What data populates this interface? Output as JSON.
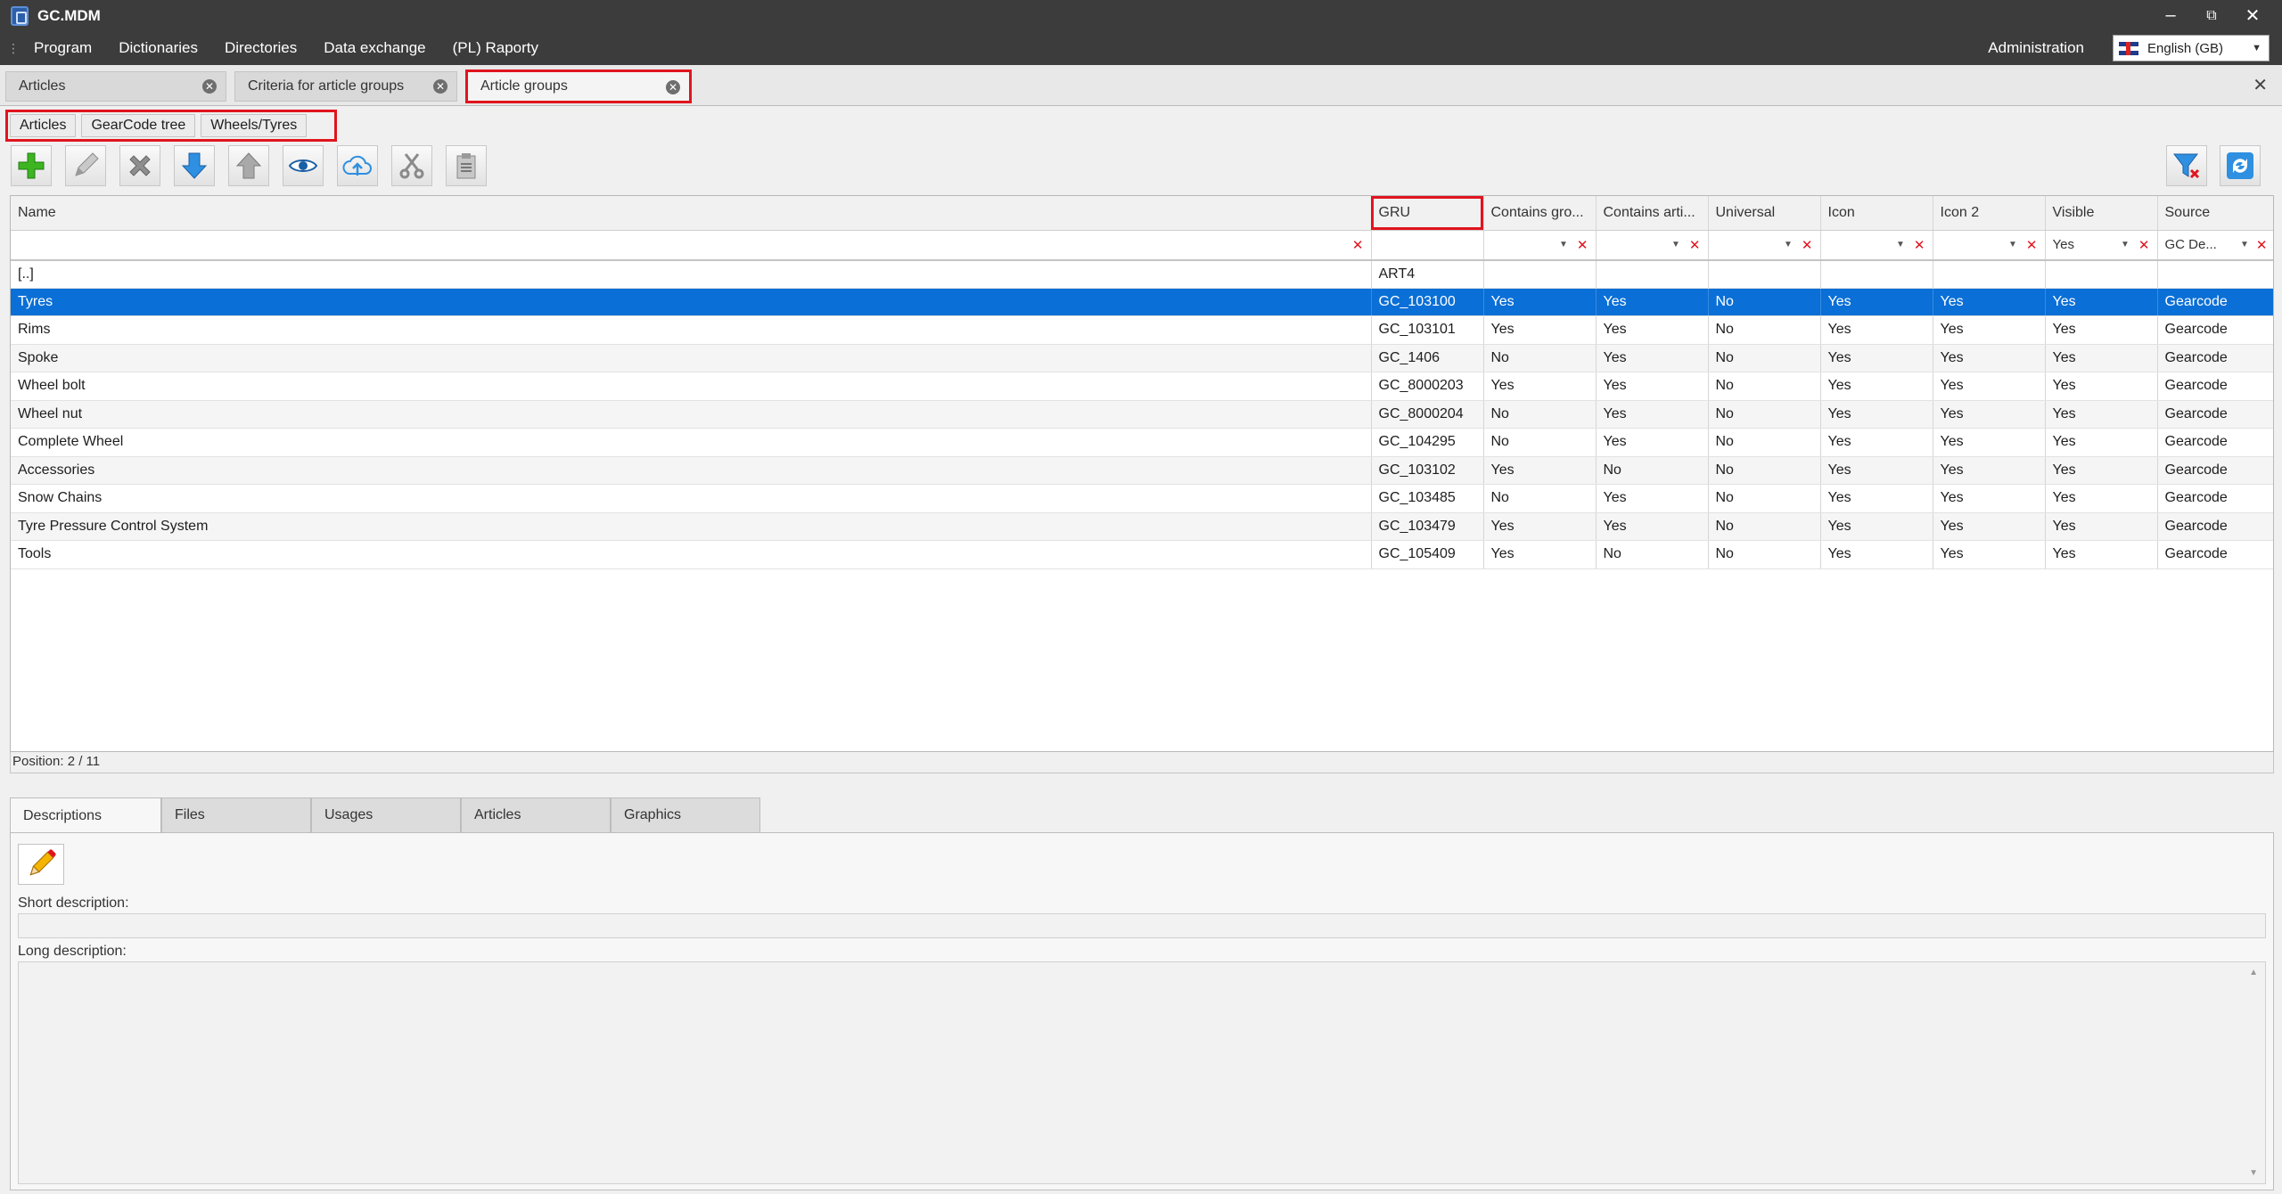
{
  "app": {
    "title": "GC.MDM"
  },
  "window_controls": {
    "minimize": "–",
    "restore": "⧉",
    "close": "✕"
  },
  "menu": {
    "items": [
      "Program",
      "Dictionaries",
      "Directories",
      "Data exchange",
      "(PL) Raporty"
    ],
    "administration": "Administration",
    "language": "English (GB)"
  },
  "doc_tabs": [
    {
      "label": "Articles"
    },
    {
      "label": "Criteria for article groups"
    },
    {
      "label": "Article groups",
      "active": true
    }
  ],
  "sub_tabs": [
    "Articles",
    "GearCode tree",
    "Wheels/Tyres"
  ],
  "toolbar": {
    "icons": [
      "add-icon",
      "edit-icon",
      "delete-icon",
      "move-down-icon",
      "move-up-icon",
      "view-icon",
      "upload-icon",
      "cut-icon",
      "paste-icon"
    ],
    "right_icons": [
      "clear-filter-icon",
      "refresh-icon"
    ]
  },
  "grid": {
    "columns": [
      "Name",
      "GRU",
      "Contains gro...",
      "Contains arti...",
      "Universal",
      "Icon",
      "Icon 2",
      "Visible",
      "Source"
    ],
    "filters": {
      "visible": "Yes",
      "source": "GC De..."
    },
    "rows": [
      [
        "[..]",
        "ART4",
        "",
        "",
        "",
        "",
        "",
        "",
        ""
      ],
      [
        "Tyres",
        "GC_103100",
        "Yes",
        "Yes",
        "No",
        "Yes",
        "Yes",
        "Yes",
        "Gearcode"
      ],
      [
        "Rims",
        "GC_103101",
        "Yes",
        "Yes",
        "No",
        "Yes",
        "Yes",
        "Yes",
        "Gearcode"
      ],
      [
        "Spoke",
        "GC_1406",
        "No",
        "Yes",
        "No",
        "Yes",
        "Yes",
        "Yes",
        "Gearcode"
      ],
      [
        "Wheel bolt",
        "GC_8000203",
        "Yes",
        "Yes",
        "No",
        "Yes",
        "Yes",
        "Yes",
        "Gearcode"
      ],
      [
        "Wheel nut",
        "GC_8000204",
        "No",
        "Yes",
        "No",
        "Yes",
        "Yes",
        "Yes",
        "Gearcode"
      ],
      [
        "Complete Wheel",
        "GC_104295",
        "No",
        "Yes",
        "No",
        "Yes",
        "Yes",
        "Yes",
        "Gearcode"
      ],
      [
        "Accessories",
        "GC_103102",
        "Yes",
        "No",
        "No",
        "Yes",
        "Yes",
        "Yes",
        "Gearcode"
      ],
      [
        "Snow Chains",
        "GC_103485",
        "No",
        "Yes",
        "No",
        "Yes",
        "Yes",
        "Yes",
        "Gearcode"
      ],
      [
        "Tyre Pressure Control System",
        "GC_103479",
        "Yes",
        "Yes",
        "No",
        "Yes",
        "Yes",
        "Yes",
        "Gearcode"
      ],
      [
        "Tools",
        "GC_105409",
        "Yes",
        "No",
        "No",
        "Yes",
        "Yes",
        "Yes",
        "Gearcode"
      ]
    ],
    "selected_row": 1
  },
  "status": {
    "position": "Position: 2 / 11"
  },
  "bottom_tabs": [
    "Descriptions",
    "Files",
    "Usages",
    "Articles",
    "Graphics"
  ],
  "details": {
    "short_description_label": "Short description:",
    "long_description_label": "Long description:"
  },
  "colors": {
    "selection": "#0a6fd6",
    "highlight": "#e0141e",
    "titlebar": "#3c3c3c"
  }
}
